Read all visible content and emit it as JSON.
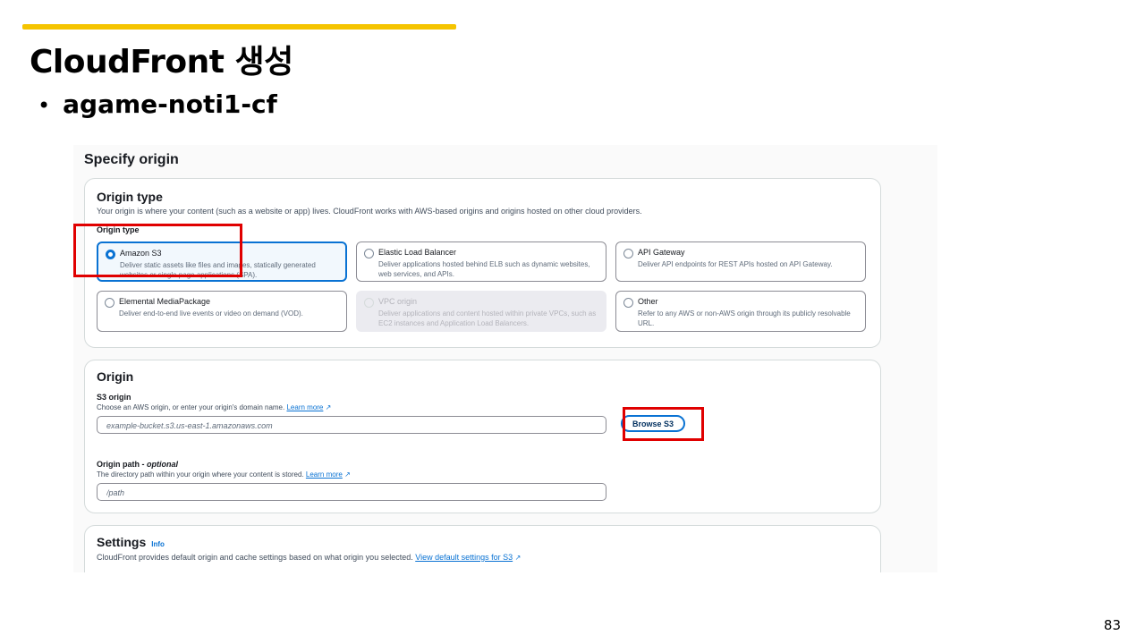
{
  "slide": {
    "title": "CloudFront 생성",
    "bullet": "agame-noti1-cf",
    "page_number": "83",
    "accent_color": "#f5c400"
  },
  "screenshot": {
    "heading": "Specify origin",
    "origin_type_panel": {
      "title": "Origin type",
      "description": "Your origin is where your content (such as a website or app) lives. CloudFront works with AWS-based origins and origins hosted on other cloud providers.",
      "group_label": "Origin type",
      "options": [
        {
          "name": "Amazon S3",
          "desc": "Deliver static assets like files and images, statically generated websites or single page applications (SPA).",
          "selected": true,
          "disabled": false
        },
        {
          "name": "Elastic Load Balancer",
          "desc": "Deliver applications hosted behind ELB such as dynamic websites, web services, and APIs.",
          "selected": false,
          "disabled": false
        },
        {
          "name": "API Gateway",
          "desc": "Deliver API endpoints for REST APIs hosted on API Gateway.",
          "selected": false,
          "disabled": false
        },
        {
          "name": "Elemental MediaPackage",
          "desc": "Deliver end-to-end live events or video on demand (VOD).",
          "selected": false,
          "disabled": false
        },
        {
          "name": "VPC origin",
          "desc": "Deliver applications and content hosted within private VPCs, such as EC2 instances and Application Load Balancers.",
          "selected": false,
          "disabled": true
        },
        {
          "name": "Other",
          "desc": "Refer to any AWS or non-AWS origin through its publicly resolvable URL.",
          "selected": false,
          "disabled": false
        }
      ]
    },
    "origin_panel": {
      "title": "Origin",
      "s3_origin": {
        "label": "S3 origin",
        "description": "Choose an AWS origin, or enter your origin's domain name.",
        "learn_more": "Learn more",
        "placeholder": "example-bucket.s3.us-east-1.amazonaws.com",
        "browse_button": "Browse S3"
      },
      "origin_path": {
        "label": "Origin path",
        "label_suffix": " - optional",
        "description": "The directory path within your origin where your content is stored.",
        "learn_more": "Learn more",
        "placeholder": "/path"
      }
    },
    "settings_panel": {
      "title": "Settings",
      "info": "Info",
      "description": "CloudFront provides default origin and cache settings based on what origin you selected.",
      "link": "View default settings for S3"
    }
  }
}
